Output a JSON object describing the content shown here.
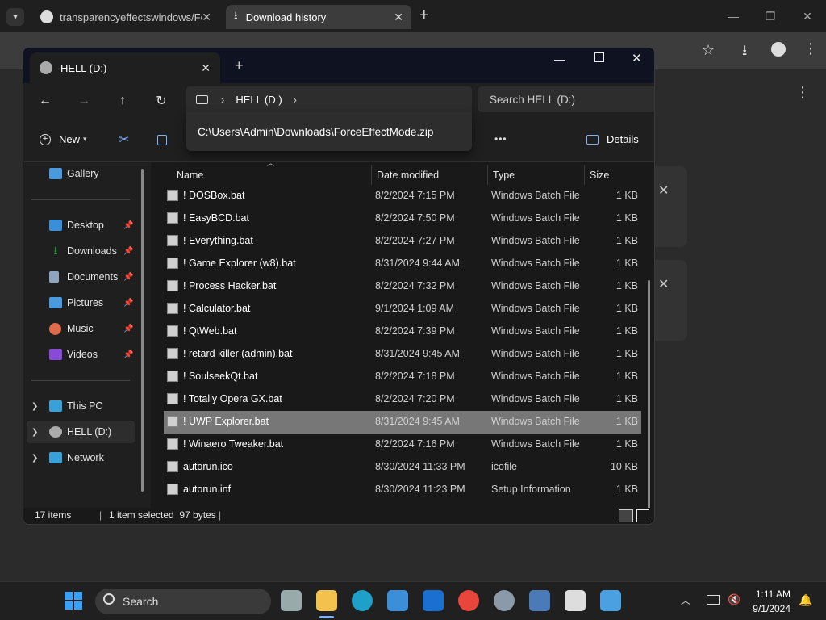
{
  "browser": {
    "tabs": [
      {
        "label": "transparencyeffectswindows/Fo"
      },
      {
        "label": "Download history"
      }
    ],
    "new_tab": "+"
  },
  "explorer": {
    "tab_title": "HELL (D:)",
    "new_tab": "+",
    "breadcrumb": {
      "drive": "HELL (D:)"
    },
    "address_suggestion": "C:\\Users\\Admin\\Downloads\\ForceEffectMode.zip",
    "search_placeholder": "Search HELL (D:)",
    "toolbar": {
      "new_label": "New",
      "details_label": "Details",
      "more": "•••"
    },
    "sidebar": {
      "gallery": "Gallery",
      "pinned": [
        {
          "label": "Desktop",
          "color": "#3a8fd8"
        },
        {
          "label": "Downloads",
          "color": "#2ea043"
        },
        {
          "label": "Documents",
          "color": "#8fa4bf"
        },
        {
          "label": "Pictures",
          "color": "#4a9ae0"
        },
        {
          "label": "Music",
          "color": "#e06a4a"
        },
        {
          "label": "Videos",
          "color": "#8a4ad8"
        }
      ],
      "tree": [
        {
          "label": "This PC"
        },
        {
          "label": "HELL (D:)"
        },
        {
          "label": "Network"
        }
      ]
    },
    "columns": {
      "name": "Name",
      "date": "Date modified",
      "type": "Type",
      "size": "Size"
    },
    "files": [
      {
        "name": "! DOSBox.bat",
        "date": "8/2/2024 7:15 PM",
        "type": "Windows Batch File",
        "size": "1 KB"
      },
      {
        "name": "! EasyBCD.bat",
        "date": "8/2/2024 7:50 PM",
        "type": "Windows Batch File",
        "size": "1 KB"
      },
      {
        "name": "! Everything.bat",
        "date": "8/2/2024 7:27 PM",
        "type": "Windows Batch File",
        "size": "1 KB"
      },
      {
        "name": "! Game Explorer (w8).bat",
        "date": "8/31/2024 9:44 AM",
        "type": "Windows Batch File",
        "size": "1 KB"
      },
      {
        "name": "! Process Hacker.bat",
        "date": "8/2/2024 7:32 PM",
        "type": "Windows Batch File",
        "size": "1 KB"
      },
      {
        "name": "! Calculator.bat",
        "date": "9/1/2024 1:09 AM",
        "type": "Windows Batch File",
        "size": "1 KB"
      },
      {
        "name": "! QtWeb.bat",
        "date": "8/2/2024 7:39 PM",
        "type": "Windows Batch File",
        "size": "1 KB"
      },
      {
        "name": "! retard killer (admin).bat",
        "date": "8/31/2024 9:45 AM",
        "type": "Windows Batch File",
        "size": "1 KB"
      },
      {
        "name": "! SoulseekQt.bat",
        "date": "8/2/2024 7:18 PM",
        "type": "Windows Batch File",
        "size": "1 KB"
      },
      {
        "name": "! Totally Opera GX.bat",
        "date": "8/2/2024 7:20 PM",
        "type": "Windows Batch File",
        "size": "1 KB"
      },
      {
        "name": "! UWP Explorer.bat",
        "date": "8/31/2024 9:45 AM",
        "type": "Windows Batch File",
        "size": "1 KB"
      },
      {
        "name": "! Winaero Tweaker.bat",
        "date": "8/2/2024 7:16 PM",
        "type": "Windows Batch File",
        "size": "1 KB"
      },
      {
        "name": "autorun.ico",
        "date": "8/30/2024 11:33 PM",
        "type": "icofile",
        "size": "10 KB"
      },
      {
        "name": "autorun.inf",
        "date": "8/30/2024 11:23 PM",
        "type": "Setup Information",
        "size": "1 KB"
      }
    ],
    "status": {
      "items": "17 items",
      "selected": "1 item selected  97 bytes"
    }
  },
  "taskbar": {
    "search_label": "Search",
    "time": "1:11 AM",
    "date": "9/1/2024"
  }
}
